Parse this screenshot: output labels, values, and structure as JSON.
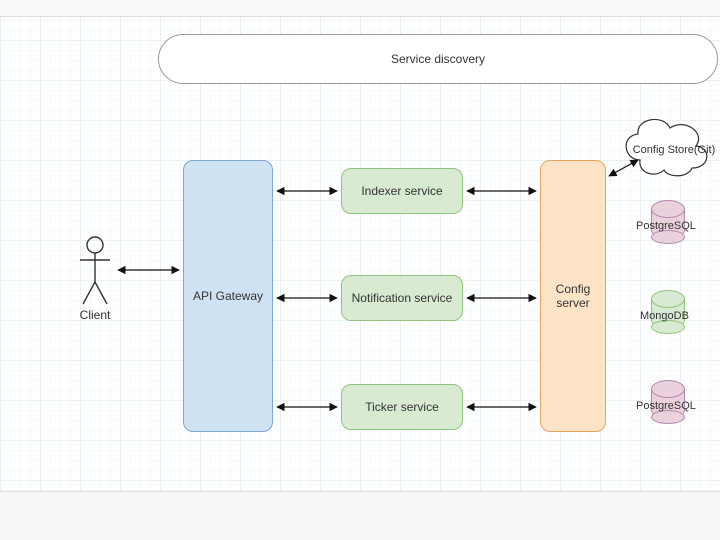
{
  "diagram": {
    "title_top": "Service discovery",
    "actor": {
      "label": "Client"
    },
    "api_gateway": "API Gateway",
    "services": {
      "indexer": "Indexer service",
      "notification": "Notification service",
      "ticker": "Ticker service"
    },
    "config_server": "Config server",
    "config_store": "Config Store(Git)",
    "databases": {
      "db1": "PostgreSQL",
      "db2": "MongoDB",
      "db3": "PostgreSQL"
    }
  }
}
